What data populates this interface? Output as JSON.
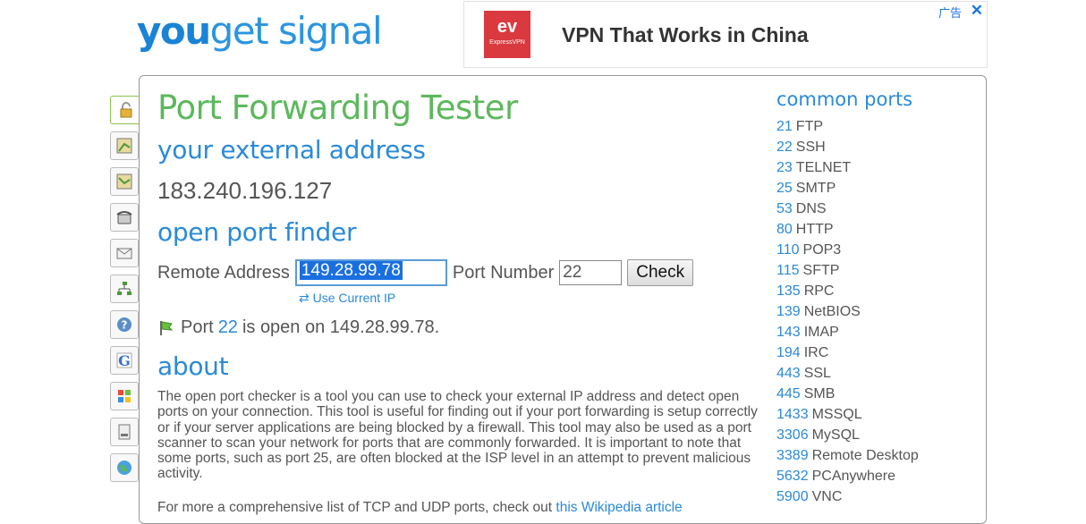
{
  "logo": {
    "you": "you",
    "rest": "get signal"
  },
  "ad": {
    "brand_logo": "ExpressVPN",
    "logo_mark": "ev",
    "text": "VPN That Works in China",
    "badge": "广告",
    "close": "✕"
  },
  "page": {
    "title": "Port Forwarding Tester",
    "external_heading": "your external address",
    "external_ip": "183.240.196.127",
    "finder_heading": "open port finder",
    "remote_label": "Remote Address",
    "remote_value": "149.28.99.78",
    "port_label": "Port Number",
    "port_value": "22",
    "check_label": "Check",
    "use_current_ip": "Use Current IP",
    "result_prefix": "Port",
    "result_port": "22",
    "result_suffix": "is open on 149.28.99.78.",
    "about_heading": "about",
    "about_text": "The open port checker is a tool you can use to check your external IP address and detect open ports on your connection. This tool is useful for finding out if your port forwarding is setup correctly or if your server applications are being blocked by a firewall. This tool may also be used as a port scanner to scan your network for ports that are commonly forwarded. It is important to note that some ports, such as port 25, are often blocked at the ISP level in an attempt to prevent malicious activity.",
    "more_text": "For more a comprehensive list of TCP and UDP ports, check out",
    "more_link": "this Wikipedia article"
  },
  "common_ports": {
    "title": "common ports",
    "items": [
      {
        "port": "21",
        "name": "FTP"
      },
      {
        "port": "22",
        "name": "SSH"
      },
      {
        "port": "23",
        "name": "TELNET"
      },
      {
        "port": "25",
        "name": "SMTP"
      },
      {
        "port": "53",
        "name": "DNS"
      },
      {
        "port": "80",
        "name": "HTTP"
      },
      {
        "port": "110",
        "name": "POP3"
      },
      {
        "port": "115",
        "name": "SFTP"
      },
      {
        "port": "135",
        "name": "RPC"
      },
      {
        "port": "139",
        "name": "NetBIOS"
      },
      {
        "port": "143",
        "name": "IMAP"
      },
      {
        "port": "194",
        "name": "IRC"
      },
      {
        "port": "443",
        "name": "SSL"
      },
      {
        "port": "445",
        "name": "SMB"
      },
      {
        "port": "1433",
        "name": "MSSQL"
      },
      {
        "port": "3306",
        "name": "MySQL"
      },
      {
        "port": "3389",
        "name": "Remote Desktop"
      },
      {
        "port": "5632",
        "name": "PCAnywhere"
      },
      {
        "port": "5900",
        "name": "VNC"
      }
    ]
  },
  "tools": [
    "lock-icon",
    "map-icon",
    "map-route-icon",
    "phone-icon",
    "envelope-icon",
    "network-icon",
    "help-icon",
    "google-icon",
    "windows-icon",
    "server-icon",
    "globe-icon"
  ],
  "colors": {
    "accent_blue": "#2a8ad8",
    "title_green": "#5cb85c",
    "ad_red": "#da3940"
  }
}
